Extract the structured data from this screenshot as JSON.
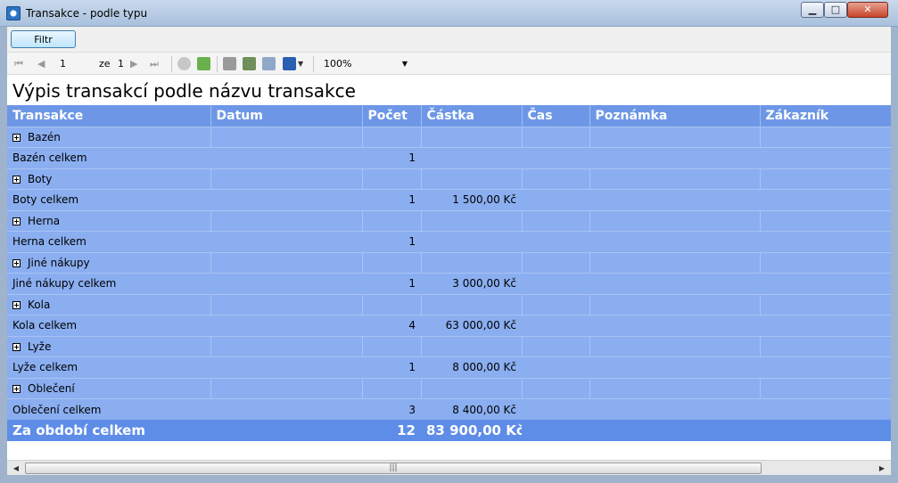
{
  "window": {
    "title": "Transakce - podle typu"
  },
  "filter": {
    "label": "Filtr"
  },
  "toolbar": {
    "page_current": "1",
    "page_of_label": "ze",
    "page_total": "1",
    "zoom": "100%"
  },
  "report": {
    "title": "Výpis transakcí podle názvu transakce",
    "columns": [
      "Transakce",
      "Datum",
      "Počet",
      "Částka",
      "Čas",
      "Poznámka",
      "Zákazník"
    ],
    "groups": [
      {
        "name": "Bazén",
        "subtotal_label": "Bazén celkem",
        "count": "1",
        "amount": ""
      },
      {
        "name": "Boty",
        "subtotal_label": "Boty celkem",
        "count": "1",
        "amount": "1 500,00 Kč"
      },
      {
        "name": "Herna",
        "subtotal_label": "Herna celkem",
        "count": "1",
        "amount": ""
      },
      {
        "name": "Jiné nákupy",
        "subtotal_label": "Jiné nákupy celkem",
        "count": "1",
        "amount": "3 000,00 Kč"
      },
      {
        "name": "Kola",
        "subtotal_label": "Kola celkem",
        "count": "4",
        "amount": "63 000,00 Kč"
      },
      {
        "name": "Lyže",
        "subtotal_label": "Lyže celkem",
        "count": "1",
        "amount": "8 000,00 Kč"
      },
      {
        "name": "Oblečení",
        "subtotal_label": "Oblečení celkem",
        "count": "3",
        "amount": "8 400,00 Kč"
      }
    ],
    "grand_total": {
      "label": "Za období celkem",
      "count": "12",
      "amount": "83 900,00 Kč"
    }
  },
  "colors": {
    "header": "#6d97e6",
    "row": "#8aaef0",
    "grand_total": "#5e8de8"
  }
}
